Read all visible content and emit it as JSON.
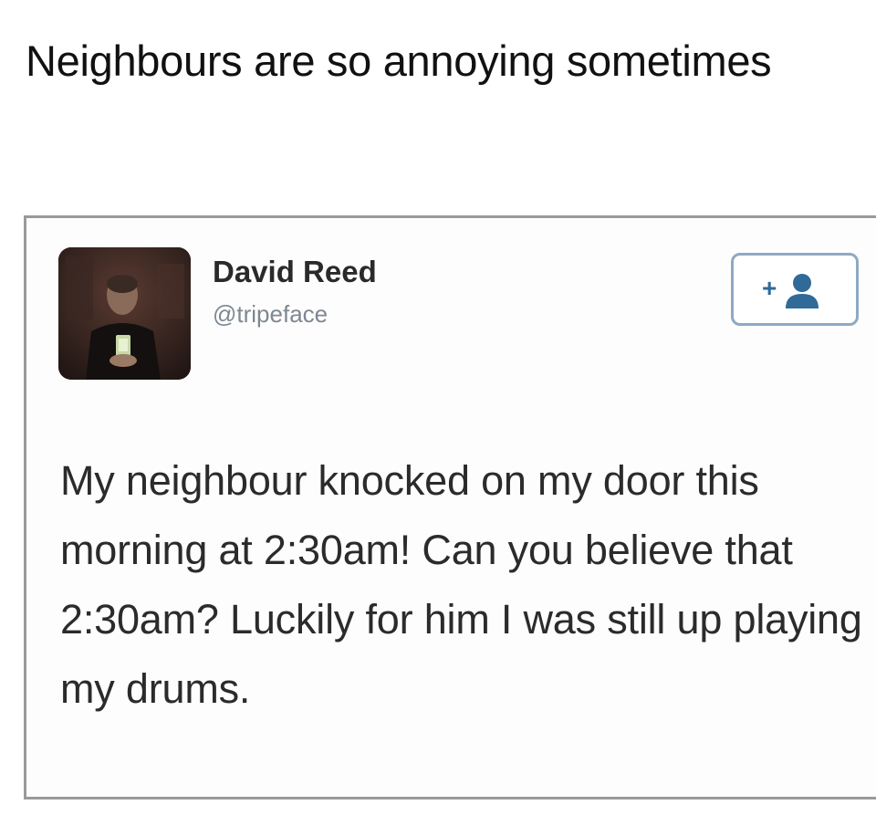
{
  "caption": "Neighbours are so annoying sometimes",
  "tweet": {
    "author": {
      "display_name": "David Reed",
      "handle": "@tripeface",
      "avatar_icon": "profile-photo"
    },
    "follow_button": {
      "icon": "add-user-icon",
      "label": "+"
    },
    "text": "My neighbour knocked on my door this morning at 2:30am! Can you believe that 2:30am? Luckily for him I was still up playing my drums."
  },
  "colors": {
    "card_border": "#9a9a9a",
    "follow_accent": "#2f6a99",
    "handle_gray": "#7f8790"
  }
}
